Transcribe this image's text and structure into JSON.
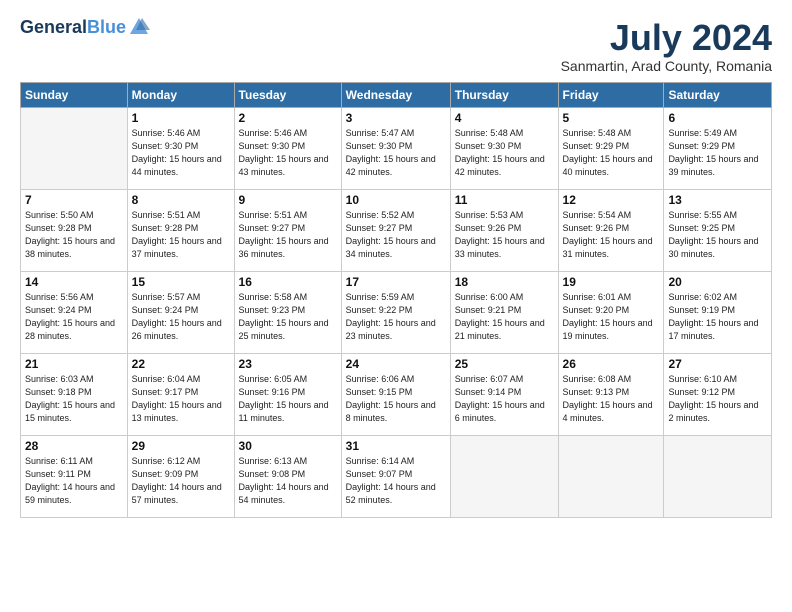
{
  "header": {
    "logo_line1": "General",
    "logo_line2": "Blue",
    "month_title": "July 2024",
    "subtitle": "Sanmartin, Arad County, Romania"
  },
  "weekdays": [
    "Sunday",
    "Monday",
    "Tuesday",
    "Wednesday",
    "Thursday",
    "Friday",
    "Saturday"
  ],
  "weeks": [
    [
      {
        "day": "",
        "empty": true
      },
      {
        "day": "1",
        "sunrise": "5:46 AM",
        "sunset": "9:30 PM",
        "daylight": "15 hours and 44 minutes."
      },
      {
        "day": "2",
        "sunrise": "5:46 AM",
        "sunset": "9:30 PM",
        "daylight": "15 hours and 43 minutes."
      },
      {
        "day": "3",
        "sunrise": "5:47 AM",
        "sunset": "9:30 PM",
        "daylight": "15 hours and 42 minutes."
      },
      {
        "day": "4",
        "sunrise": "5:48 AM",
        "sunset": "9:30 PM",
        "daylight": "15 hours and 42 minutes."
      },
      {
        "day": "5",
        "sunrise": "5:48 AM",
        "sunset": "9:29 PM",
        "daylight": "15 hours and 40 minutes."
      },
      {
        "day": "6",
        "sunrise": "5:49 AM",
        "sunset": "9:29 PM",
        "daylight": "15 hours and 39 minutes."
      }
    ],
    [
      {
        "day": "7",
        "sunrise": "5:50 AM",
        "sunset": "9:28 PM",
        "daylight": "15 hours and 38 minutes."
      },
      {
        "day": "8",
        "sunrise": "5:51 AM",
        "sunset": "9:28 PM",
        "daylight": "15 hours and 37 minutes."
      },
      {
        "day": "9",
        "sunrise": "5:51 AM",
        "sunset": "9:27 PM",
        "daylight": "15 hours and 36 minutes."
      },
      {
        "day": "10",
        "sunrise": "5:52 AM",
        "sunset": "9:27 PM",
        "daylight": "15 hours and 34 minutes."
      },
      {
        "day": "11",
        "sunrise": "5:53 AM",
        "sunset": "9:26 PM",
        "daylight": "15 hours and 33 minutes."
      },
      {
        "day": "12",
        "sunrise": "5:54 AM",
        "sunset": "9:26 PM",
        "daylight": "15 hours and 31 minutes."
      },
      {
        "day": "13",
        "sunrise": "5:55 AM",
        "sunset": "9:25 PM",
        "daylight": "15 hours and 30 minutes."
      }
    ],
    [
      {
        "day": "14",
        "sunrise": "5:56 AM",
        "sunset": "9:24 PM",
        "daylight": "15 hours and 28 minutes."
      },
      {
        "day": "15",
        "sunrise": "5:57 AM",
        "sunset": "9:24 PM",
        "daylight": "15 hours and 26 minutes."
      },
      {
        "day": "16",
        "sunrise": "5:58 AM",
        "sunset": "9:23 PM",
        "daylight": "15 hours and 25 minutes."
      },
      {
        "day": "17",
        "sunrise": "5:59 AM",
        "sunset": "9:22 PM",
        "daylight": "15 hours and 23 minutes."
      },
      {
        "day": "18",
        "sunrise": "6:00 AM",
        "sunset": "9:21 PM",
        "daylight": "15 hours and 21 minutes."
      },
      {
        "day": "19",
        "sunrise": "6:01 AM",
        "sunset": "9:20 PM",
        "daylight": "15 hours and 19 minutes."
      },
      {
        "day": "20",
        "sunrise": "6:02 AM",
        "sunset": "9:19 PM",
        "daylight": "15 hours and 17 minutes."
      }
    ],
    [
      {
        "day": "21",
        "sunrise": "6:03 AM",
        "sunset": "9:18 PM",
        "daylight": "15 hours and 15 minutes."
      },
      {
        "day": "22",
        "sunrise": "6:04 AM",
        "sunset": "9:17 PM",
        "daylight": "15 hours and 13 minutes."
      },
      {
        "day": "23",
        "sunrise": "6:05 AM",
        "sunset": "9:16 PM",
        "daylight": "15 hours and 11 minutes."
      },
      {
        "day": "24",
        "sunrise": "6:06 AM",
        "sunset": "9:15 PM",
        "daylight": "15 hours and 8 minutes."
      },
      {
        "day": "25",
        "sunrise": "6:07 AM",
        "sunset": "9:14 PM",
        "daylight": "15 hours and 6 minutes."
      },
      {
        "day": "26",
        "sunrise": "6:08 AM",
        "sunset": "9:13 PM",
        "daylight": "15 hours and 4 minutes."
      },
      {
        "day": "27",
        "sunrise": "6:10 AM",
        "sunset": "9:12 PM",
        "daylight": "15 hours and 2 minutes."
      }
    ],
    [
      {
        "day": "28",
        "sunrise": "6:11 AM",
        "sunset": "9:11 PM",
        "daylight": "14 hours and 59 minutes."
      },
      {
        "day": "29",
        "sunrise": "6:12 AM",
        "sunset": "9:09 PM",
        "daylight": "14 hours and 57 minutes."
      },
      {
        "day": "30",
        "sunrise": "6:13 AM",
        "sunset": "9:08 PM",
        "daylight": "14 hours and 54 minutes."
      },
      {
        "day": "31",
        "sunrise": "6:14 AM",
        "sunset": "9:07 PM",
        "daylight": "14 hours and 52 minutes."
      },
      {
        "day": "",
        "empty": true
      },
      {
        "day": "",
        "empty": true
      },
      {
        "day": "",
        "empty": true
      }
    ]
  ]
}
